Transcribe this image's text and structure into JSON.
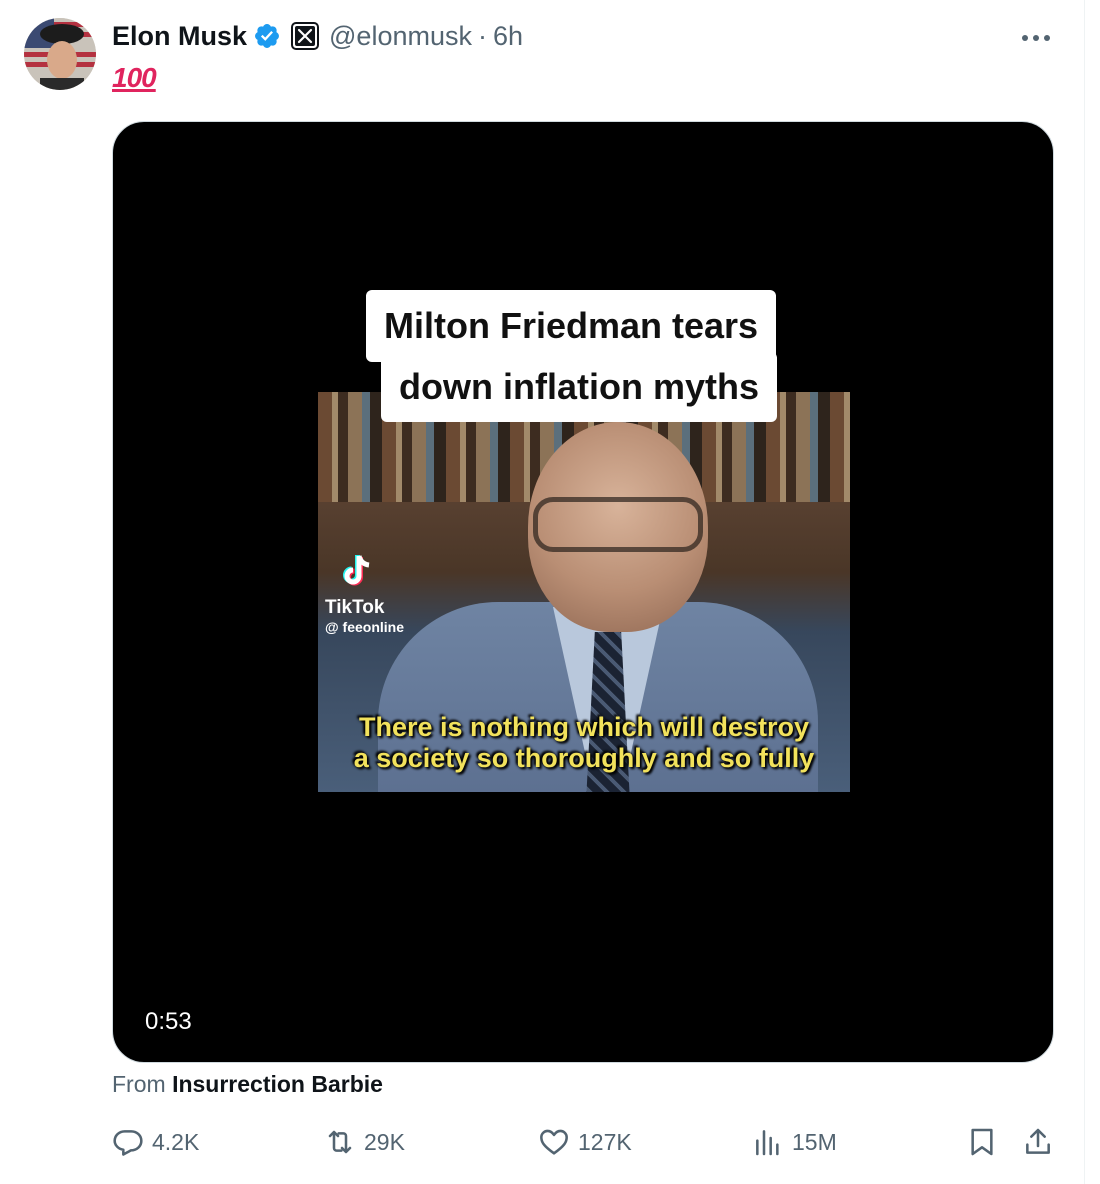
{
  "author": {
    "name": "Elon Musk",
    "handle": "@elonmusk",
    "separator": "·",
    "time": "6h"
  },
  "tweet": {
    "text": "100"
  },
  "media": {
    "caption_line1": "Milton Friedman tears",
    "caption_line2": "down inflation myths",
    "watermark_brand": "TikTok",
    "watermark_handle": "@ feeonline",
    "subtitle_line1": "There is nothing which will destroy",
    "subtitle_line2": "a society so thoroughly and so fully",
    "duration": "0:53"
  },
  "source": {
    "prefix": "From",
    "name": "Insurrection Barbie"
  },
  "actions": {
    "replies": "4.2K",
    "reposts": "29K",
    "likes": "127K",
    "views": "15M"
  },
  "colors": {
    "verified": "#1d9bf0",
    "text_secondary": "#536471",
    "hundred_emoji": "#e0245e",
    "subtitle": "#f2e25c"
  }
}
